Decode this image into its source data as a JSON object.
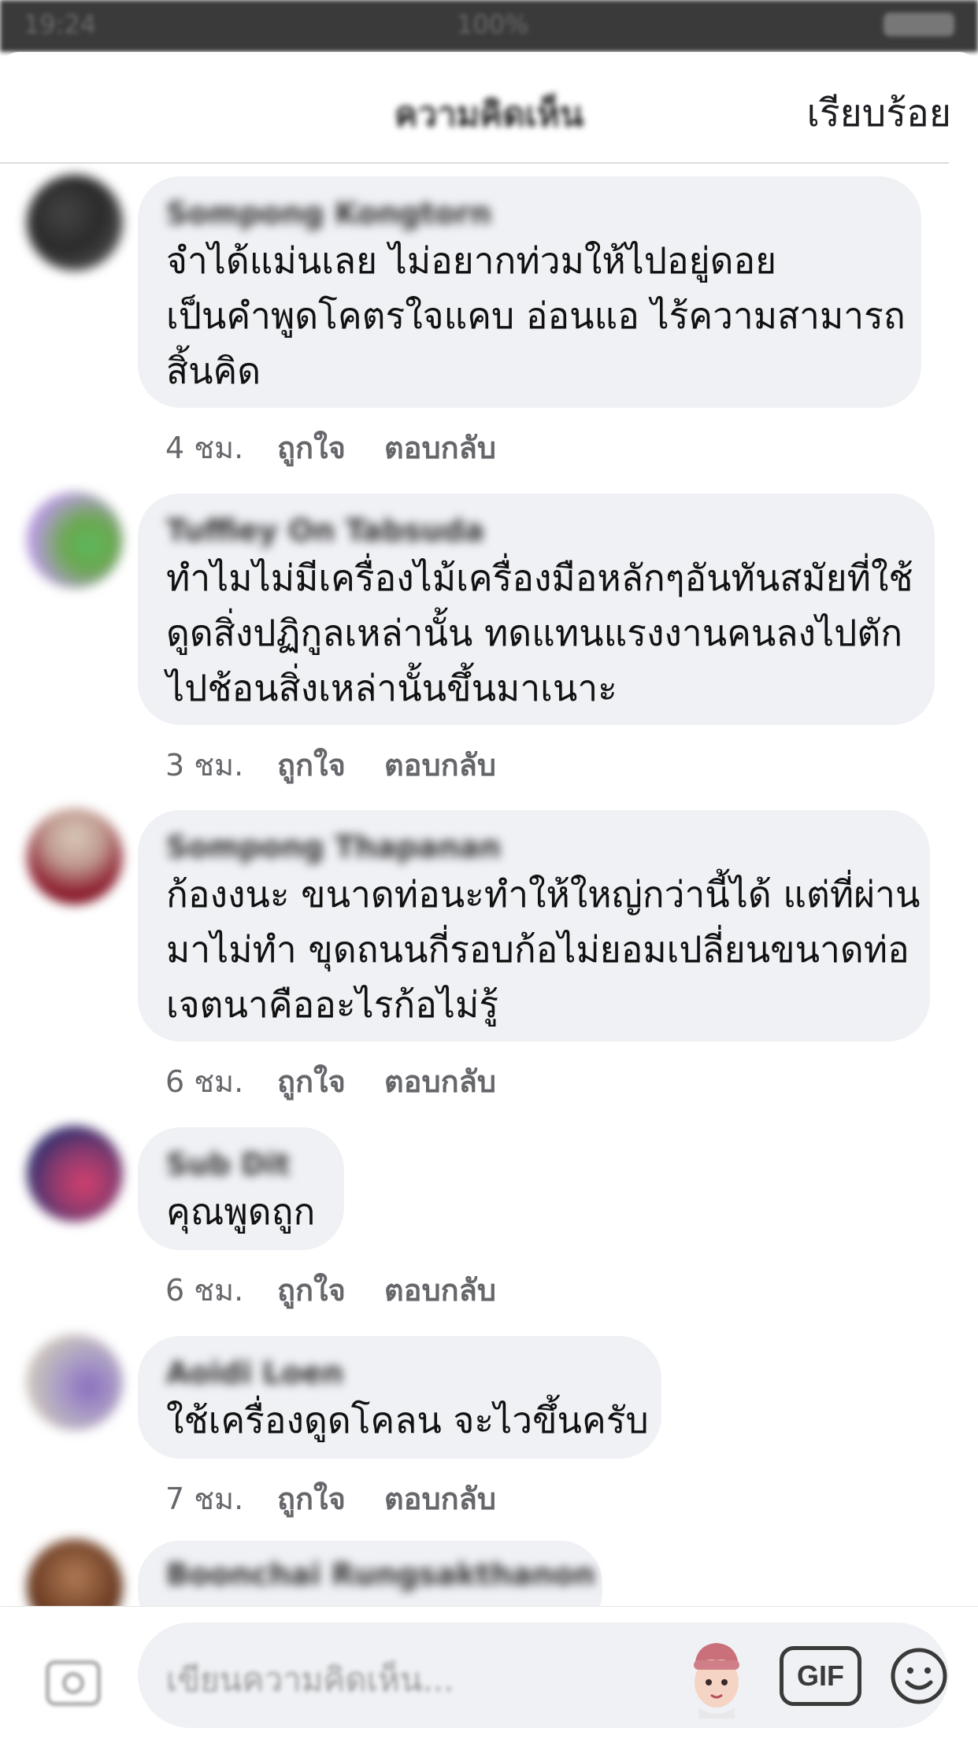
{
  "status_bar": {
    "time": "19:24",
    "center": "100%"
  },
  "header": {
    "title": "ความคิดเห็น",
    "done_label": "เรียบร้อย"
  },
  "comments": [
    {
      "author": "Sompong Kongtorn",
      "lines": [
        "จำได้แม่นเลย ไม่อยากท่วมให้ไปอยู่ดอย",
        "เป็นคำพูดโคตรใจแคบ อ่อนแอ ไร้ความสามารถ",
        "สิ้นคิด"
      ],
      "time": "4 ชม.",
      "like": "ถูกใจ",
      "reply": "ตอบกลับ",
      "avatar_colors": [
        "#2a2a2a",
        "#6b6b6b"
      ]
    },
    {
      "author": "Tuffiey On Tabsuda",
      "lines": [
        "ทำไมไม่มีเครื่องไม้เครื่องมือหลักๆอันทันสมัยที่ใช้",
        "ดูดสิ่งปฏิกูลเหล่านั้น ทดแทนแรงงานคนลงไปตัก",
        "ไปช้อนสิ่งเหล่านั้นขึ้นมาเนาะ"
      ],
      "time": "3 ชม.",
      "like": "ถูกใจ",
      "reply": "ตอบกลับ",
      "avatar_colors": [
        "#6aa84f",
        "#b99be0"
      ]
    },
    {
      "author": "Sompong Thapanan",
      "lines": [
        "ก้องงนะ ขนาดท่อนะทำให้ใหญ่กว่านี้ได้ แต่ที่ผ่าน",
        "มาไม่ทำ ขุดถนนกี่รอบก้อไม่ยอมเปลี่ยนขนาดท่อ",
        "เจตนาคืออะไรก้อไม่รู้"
      ],
      "time": "6 ชม.",
      "like": "ถูกใจ",
      "reply": "ตอบกลับ",
      "avatar_colors": [
        "#8b1a2b",
        "#d8c8b8"
      ]
    },
    {
      "author": "Sub Dit",
      "lines": [
        "คุณพูดถูก"
      ],
      "time": "6 ชม.",
      "like": "ถูกใจ",
      "reply": "ตอบกลับ",
      "avatar_colors": [
        "#2b2f6e",
        "#d1406e"
      ]
    },
    {
      "author": "Aoidi Loen",
      "lines": [
        "ใช้เครื่องดูดโคลน จะไวขึ้นครับ"
      ],
      "time": "7 ชม.",
      "like": "ถูกใจ",
      "reply": "ตอบกลับ",
      "avatar_colors": [
        "#c9c2bd",
        "#8a6fc0"
      ]
    },
    {
      "author": "Boonchai Rungsakthanon",
      "lines": [],
      "time": "",
      "like": "",
      "reply": "",
      "avatar_colors": [
        "#6b3b22",
        "#b07a55"
      ]
    }
  ],
  "composer": {
    "placeholder": "เขียนความคิดเห็น...",
    "gif_label": "GIF"
  },
  "colors": {
    "bubble": "#f0f1f5",
    "meta": "#65676b"
  }
}
